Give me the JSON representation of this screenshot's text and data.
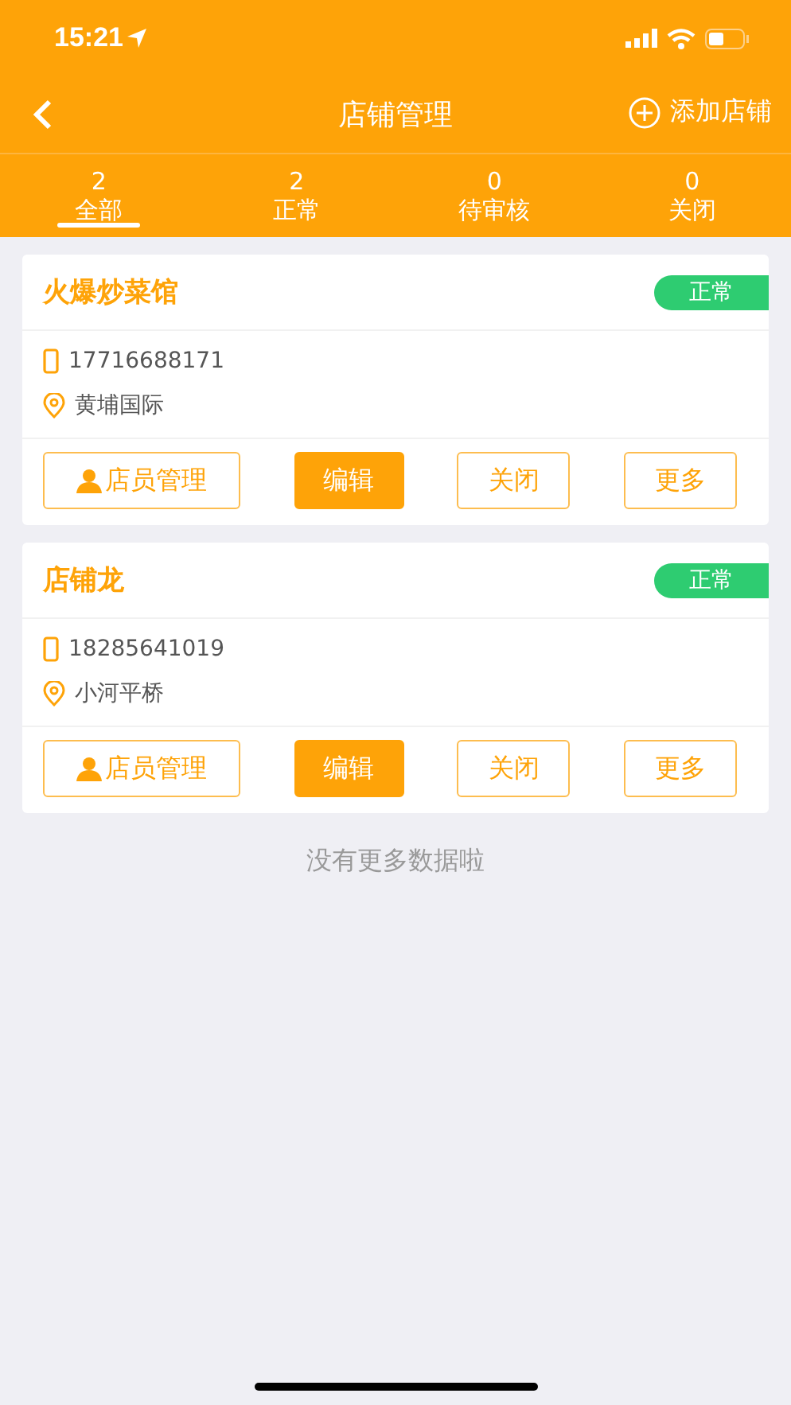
{
  "status_bar": {
    "time": "15:21"
  },
  "nav": {
    "title": "店铺管理",
    "action": "添加店铺"
  },
  "tabs": [
    {
      "count": "2",
      "label": "全部",
      "selected": true
    },
    {
      "count": "2",
      "label": "正常",
      "selected": false
    },
    {
      "count": "0",
      "label": "待审核",
      "selected": false
    },
    {
      "count": "0",
      "label": "关闭",
      "selected": false
    }
  ],
  "stores": [
    {
      "name": "火爆炒菜馆",
      "status": "正常",
      "phone": "17716688171",
      "address": "黄埔国际",
      "buttons": [
        {
          "label": "店员管理",
          "kind": "staff"
        },
        {
          "label": "编辑",
          "kind": "filled"
        },
        {
          "label": "关闭",
          "kind": "outline"
        },
        {
          "label": "更多",
          "kind": "outline"
        }
      ]
    },
    {
      "name": "店铺龙",
      "status": "正常",
      "phone": "18285641019",
      "address": "小河平桥",
      "buttons": [
        {
          "label": "店员管理",
          "kind": "staff"
        },
        {
          "label": "编辑",
          "kind": "filled"
        },
        {
          "label": "关闭",
          "kind": "outline"
        },
        {
          "label": "更多",
          "kind": "outline"
        }
      ]
    }
  ],
  "footer": "没有更多数据啦"
}
